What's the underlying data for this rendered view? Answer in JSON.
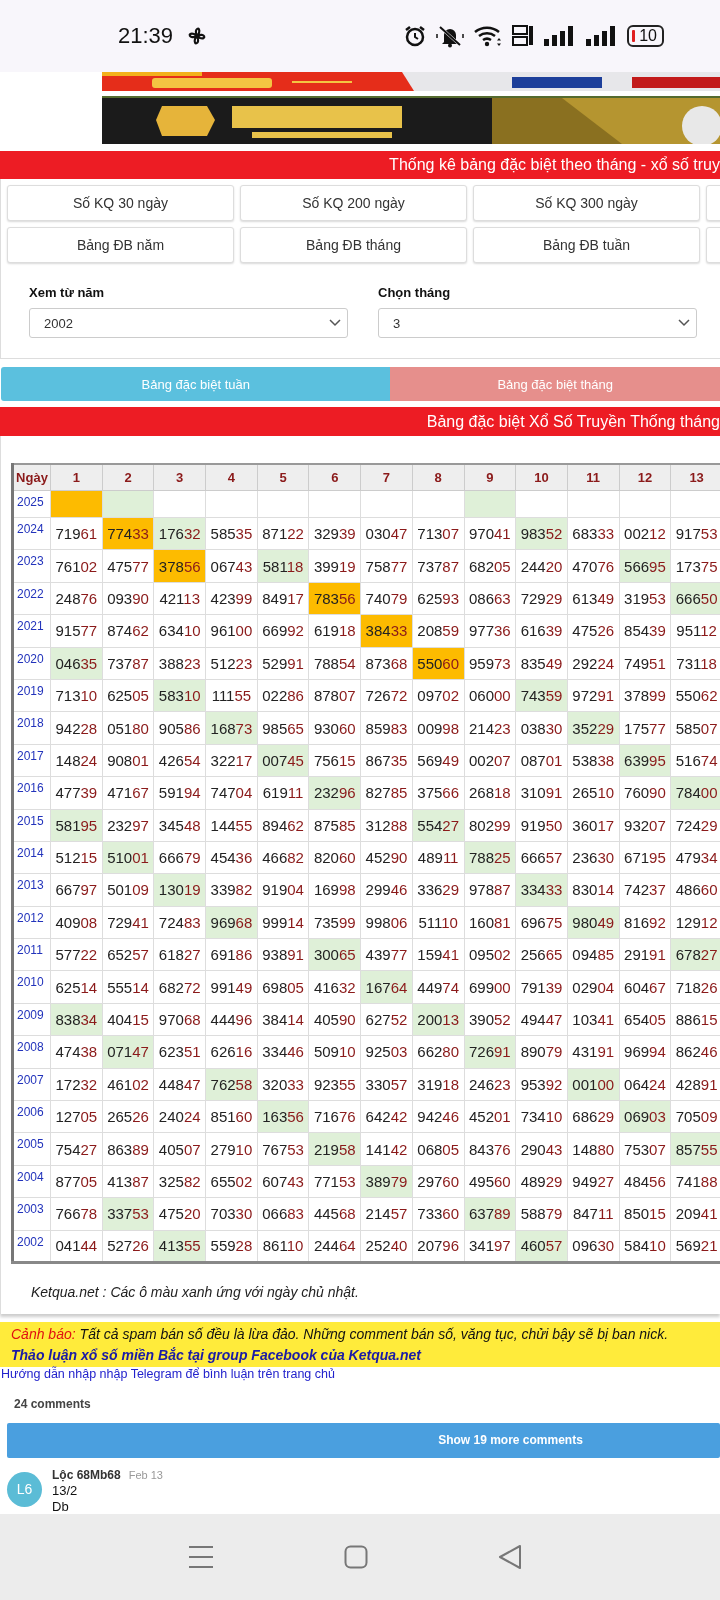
{
  "status_bar": {
    "time": "21:39",
    "battery": "10"
  },
  "stats_header": {
    "title": "Thống kê bảng đặc biệt theo tháng - xổ số truy"
  },
  "nav_buttons": [
    "Số KQ 30 ngày",
    "Số KQ 200 ngày",
    "Số KQ 300 ngày",
    "Bảng ĐB năm",
    "Bảng ĐB tháng",
    "Bảng ĐB tuần"
  ],
  "filters": [
    {
      "label": "Xem từ năm",
      "value": "2002"
    },
    {
      "label": "Chọn tháng",
      "value": "3"
    }
  ],
  "tabs": [
    {
      "label": "Bảng đặc biệt tuần",
      "color": "#5bc0de"
    },
    {
      "label": "Bảng đặc biệt tháng",
      "color": "#e68f8c"
    }
  ],
  "table": {
    "title": "Bảng đặc biệt Xổ Số Truyền Thống tháng",
    "corner_header": "Ngày",
    "columns": [
      "1",
      "2",
      "3",
      "4",
      "5",
      "6",
      "7",
      "8",
      "9",
      "10",
      "11",
      "12",
      "13"
    ],
    "rows": [
      {
        "year": "2025",
        "cells": [
          {
            "kind": "top"
          },
          {
            "kind": "sunday"
          },
          {
            "kind": "plain"
          },
          {
            "kind": "plain"
          },
          {
            "kind": "plain"
          },
          {
            "kind": "plain"
          },
          {
            "kind": "plain"
          },
          {
            "kind": "plain"
          },
          {
            "kind": "sunday"
          },
          {
            "kind": "plain"
          },
          {
            "kind": "plain"
          },
          {
            "kind": "plain"
          },
          {
            "kind": "plain"
          }
        ]
      },
      {
        "year": "2024",
        "cells": [
          {
            "value": "71961",
            "kind": "plain"
          },
          {
            "value": "77433",
            "kind": "top"
          },
          {
            "value": "17632",
            "kind": "sunday"
          },
          {
            "value": "58535",
            "kind": "plain"
          },
          {
            "value": "87122",
            "kind": "plain"
          },
          {
            "value": "32939",
            "kind": "plain"
          },
          {
            "value": "03047",
            "kind": "plain"
          },
          {
            "value": "71307",
            "kind": "plain"
          },
          {
            "value": "97041",
            "kind": "plain"
          },
          {
            "value": "98352",
            "kind": "sunday"
          },
          {
            "value": "68333",
            "kind": "plain"
          },
          {
            "value": "00212",
            "kind": "plain"
          },
          {
            "value": "91753",
            "kind": "plain"
          }
        ]
      },
      {
        "year": "2023",
        "cells": [
          {
            "value": "76102",
            "kind": "plain"
          },
          {
            "value": "47577",
            "kind": "plain"
          },
          {
            "value": "37856",
            "kind": "top"
          },
          {
            "value": "06743",
            "kind": "plain"
          },
          {
            "value": "58118",
            "kind": "sunday"
          },
          {
            "value": "39919",
            "kind": "plain"
          },
          {
            "value": "75877",
            "kind": "plain"
          },
          {
            "value": "73787",
            "kind": "plain"
          },
          {
            "value": "68205",
            "kind": "plain"
          },
          {
            "value": "24420",
            "kind": "plain"
          },
          {
            "value": "47076",
            "kind": "plain"
          },
          {
            "value": "56695",
            "kind": "sunday"
          },
          {
            "value": "17375",
            "kind": "plain"
          }
        ]
      },
      {
        "year": "2022",
        "cells": [
          {
            "value": "24876",
            "kind": "plain"
          },
          {
            "value": "09390",
            "kind": "plain"
          },
          {
            "value": "42113",
            "kind": "plain"
          },
          {
            "value": "42399",
            "kind": "plain"
          },
          {
            "value": "84917",
            "kind": "plain"
          },
          {
            "value": "78356",
            "kind": "top"
          },
          {
            "value": "74079",
            "kind": "plain"
          },
          {
            "value": "62593",
            "kind": "plain"
          },
          {
            "value": "08663",
            "kind": "plain"
          },
          {
            "value": "72929",
            "kind": "plain"
          },
          {
            "value": "61349",
            "kind": "plain"
          },
          {
            "value": "31953",
            "kind": "plain"
          },
          {
            "value": "66650",
            "kind": "sunday"
          }
        ]
      },
      {
        "year": "2021",
        "cells": [
          {
            "value": "91577",
            "kind": "plain"
          },
          {
            "value": "87462",
            "kind": "plain"
          },
          {
            "value": "63410",
            "kind": "plain"
          },
          {
            "value": "96100",
            "kind": "plain"
          },
          {
            "value": "66992",
            "kind": "plain"
          },
          {
            "value": "61918",
            "kind": "plain"
          },
          {
            "value": "38433",
            "kind": "top"
          },
          {
            "value": "20859",
            "kind": "plain"
          },
          {
            "value": "97736",
            "kind": "plain"
          },
          {
            "value": "61639",
            "kind": "plain"
          },
          {
            "value": "47526",
            "kind": "plain"
          },
          {
            "value": "85439",
            "kind": "plain"
          },
          {
            "value": "95112",
            "kind": "plain"
          }
        ]
      },
      {
        "year": "2020",
        "cells": [
          {
            "value": "04635",
            "kind": "sunday"
          },
          {
            "value": "73787",
            "kind": "plain"
          },
          {
            "value": "38823",
            "kind": "plain"
          },
          {
            "value": "51223",
            "kind": "plain"
          },
          {
            "value": "52991",
            "kind": "plain"
          },
          {
            "value": "78854",
            "kind": "plain"
          },
          {
            "value": "87368",
            "kind": "plain"
          },
          {
            "value": "55060",
            "kind": "top"
          },
          {
            "value": "95973",
            "kind": "plain"
          },
          {
            "value": "83549",
            "kind": "plain"
          },
          {
            "value": "29224",
            "kind": "plain"
          },
          {
            "value": "74951",
            "kind": "plain"
          },
          {
            "value": "73118",
            "kind": "plain"
          }
        ]
      },
      {
        "year": "2019",
        "cells": [
          {
            "value": "71310",
            "kind": "plain"
          },
          {
            "value": "62505",
            "kind": "plain"
          },
          {
            "value": "58310",
            "kind": "sunday"
          },
          {
            "value": "11155",
            "kind": "plain"
          },
          {
            "value": "02286",
            "kind": "plain"
          },
          {
            "value": "87807",
            "kind": "plain"
          },
          {
            "value": "72672",
            "kind": "plain"
          },
          {
            "value": "09702",
            "kind": "plain"
          },
          {
            "value": "06000",
            "kind": "plain"
          },
          {
            "value": "74359",
            "kind": "sunday"
          },
          {
            "value": "97291",
            "kind": "plain"
          },
          {
            "value": "37899",
            "kind": "plain"
          },
          {
            "value": "55062",
            "kind": "plain"
          }
        ]
      },
      {
        "year": "2018",
        "cells": [
          {
            "value": "94228",
            "kind": "plain"
          },
          {
            "value": "05180",
            "kind": "plain"
          },
          {
            "value": "90586",
            "kind": "plain"
          },
          {
            "value": "16873",
            "kind": "sunday"
          },
          {
            "value": "98565",
            "kind": "plain"
          },
          {
            "value": "93060",
            "kind": "plain"
          },
          {
            "value": "85983",
            "kind": "plain"
          },
          {
            "value": "00998",
            "kind": "plain"
          },
          {
            "value": "21423",
            "kind": "plain"
          },
          {
            "value": "03830",
            "kind": "plain"
          },
          {
            "value": "35229",
            "kind": "sunday"
          },
          {
            "value": "17577",
            "kind": "plain"
          },
          {
            "value": "58507",
            "kind": "plain"
          }
        ]
      },
      {
        "year": "2017",
        "cells": [
          {
            "value": "14824",
            "kind": "plain"
          },
          {
            "value": "90801",
            "kind": "plain"
          },
          {
            "value": "42654",
            "kind": "plain"
          },
          {
            "value": "32217",
            "kind": "plain"
          },
          {
            "value": "00745",
            "kind": "sunday"
          },
          {
            "value": "75615",
            "kind": "plain"
          },
          {
            "value": "86735",
            "kind": "plain"
          },
          {
            "value": "56949",
            "kind": "plain"
          },
          {
            "value": "00207",
            "kind": "plain"
          },
          {
            "value": "08701",
            "kind": "plain"
          },
          {
            "value": "53838",
            "kind": "plain"
          },
          {
            "value": "63995",
            "kind": "sunday"
          },
          {
            "value": "51674",
            "kind": "plain"
          }
        ]
      },
      {
        "year": "2016",
        "cells": [
          {
            "value": "47739",
            "kind": "plain"
          },
          {
            "value": "47167",
            "kind": "plain"
          },
          {
            "value": "59194",
            "kind": "plain"
          },
          {
            "value": "74704",
            "kind": "plain"
          },
          {
            "value": "61911",
            "kind": "plain"
          },
          {
            "value": "23296",
            "kind": "sunday"
          },
          {
            "value": "82785",
            "kind": "plain"
          },
          {
            "value": "37566",
            "kind": "plain"
          },
          {
            "value": "26818",
            "kind": "plain"
          },
          {
            "value": "31091",
            "kind": "plain"
          },
          {
            "value": "26510",
            "kind": "plain"
          },
          {
            "value": "76090",
            "kind": "plain"
          },
          {
            "value": "78400",
            "kind": "sunday"
          }
        ]
      },
      {
        "year": "2015",
        "cells": [
          {
            "value": "58195",
            "kind": "sunday"
          },
          {
            "value": "23297",
            "kind": "plain"
          },
          {
            "value": "34548",
            "kind": "plain"
          },
          {
            "value": "14455",
            "kind": "plain"
          },
          {
            "value": "89462",
            "kind": "plain"
          },
          {
            "value": "87585",
            "kind": "plain"
          },
          {
            "value": "31288",
            "kind": "plain"
          },
          {
            "value": "55427",
            "kind": "sunday"
          },
          {
            "value": "80299",
            "kind": "plain"
          },
          {
            "value": "91950",
            "kind": "plain"
          },
          {
            "value": "36017",
            "kind": "plain"
          },
          {
            "value": "93207",
            "kind": "plain"
          },
          {
            "value": "72429",
            "kind": "plain"
          }
        ]
      },
      {
        "year": "2014",
        "cells": [
          {
            "value": "51215",
            "kind": "plain"
          },
          {
            "value": "51001",
            "kind": "sunday"
          },
          {
            "value": "66679",
            "kind": "plain"
          },
          {
            "value": "45436",
            "kind": "plain"
          },
          {
            "value": "46682",
            "kind": "plain"
          },
          {
            "value": "82060",
            "kind": "plain"
          },
          {
            "value": "45290",
            "kind": "plain"
          },
          {
            "value": "48911",
            "kind": "plain"
          },
          {
            "value": "78825",
            "kind": "sunday"
          },
          {
            "value": "66657",
            "kind": "plain"
          },
          {
            "value": "23630",
            "kind": "plain"
          },
          {
            "value": "67195",
            "kind": "plain"
          },
          {
            "value": "47934",
            "kind": "plain"
          }
        ]
      },
      {
        "year": "2013",
        "cells": [
          {
            "value": "66797",
            "kind": "plain"
          },
          {
            "value": "50109",
            "kind": "plain"
          },
          {
            "value": "13019",
            "kind": "sunday"
          },
          {
            "value": "33982",
            "kind": "plain"
          },
          {
            "value": "91904",
            "kind": "plain"
          },
          {
            "value": "16998",
            "kind": "plain"
          },
          {
            "value": "29946",
            "kind": "plain"
          },
          {
            "value": "33629",
            "kind": "plain"
          },
          {
            "value": "97887",
            "kind": "plain"
          },
          {
            "value": "33433",
            "kind": "sunday"
          },
          {
            "value": "83014",
            "kind": "plain"
          },
          {
            "value": "74237",
            "kind": "plain"
          },
          {
            "value": "48660",
            "kind": "plain"
          }
        ]
      },
      {
        "year": "2012",
        "cells": [
          {
            "value": "40908",
            "kind": "plain"
          },
          {
            "value": "72941",
            "kind": "plain"
          },
          {
            "value": "72483",
            "kind": "plain"
          },
          {
            "value": "96968",
            "kind": "sunday"
          },
          {
            "value": "99914",
            "kind": "plain"
          },
          {
            "value": "73599",
            "kind": "plain"
          },
          {
            "value": "99806",
            "kind": "plain"
          },
          {
            "value": "51110",
            "kind": "plain"
          },
          {
            "value": "16081",
            "kind": "plain"
          },
          {
            "value": "69675",
            "kind": "plain"
          },
          {
            "value": "98049",
            "kind": "sunday"
          },
          {
            "value": "81692",
            "kind": "plain"
          },
          {
            "value": "12912",
            "kind": "plain"
          }
        ]
      },
      {
        "year": "2011",
        "cells": [
          {
            "value": "57722",
            "kind": "plain"
          },
          {
            "value": "65257",
            "kind": "plain"
          },
          {
            "value": "61827",
            "kind": "plain"
          },
          {
            "value": "69186",
            "kind": "plain"
          },
          {
            "value": "93891",
            "kind": "plain"
          },
          {
            "value": "30065",
            "kind": "sunday"
          },
          {
            "value": "43977",
            "kind": "plain"
          },
          {
            "value": "15941",
            "kind": "plain"
          },
          {
            "value": "09502",
            "kind": "plain"
          },
          {
            "value": "25665",
            "kind": "plain"
          },
          {
            "value": "09485",
            "kind": "plain"
          },
          {
            "value": "29191",
            "kind": "plain"
          },
          {
            "value": "67827",
            "kind": "sunday"
          }
        ]
      },
      {
        "year": "2010",
        "cells": [
          {
            "value": "62514",
            "kind": "plain"
          },
          {
            "value": "55514",
            "kind": "plain"
          },
          {
            "value": "68272",
            "kind": "plain"
          },
          {
            "value": "99149",
            "kind": "plain"
          },
          {
            "value": "69805",
            "kind": "plain"
          },
          {
            "value": "41632",
            "kind": "plain"
          },
          {
            "value": "16764",
            "kind": "sunday"
          },
          {
            "value": "44974",
            "kind": "plain"
          },
          {
            "value": "69900",
            "kind": "plain"
          },
          {
            "value": "79139",
            "kind": "plain"
          },
          {
            "value": "02904",
            "kind": "plain"
          },
          {
            "value": "60467",
            "kind": "plain"
          },
          {
            "value": "71826",
            "kind": "plain"
          }
        ]
      },
      {
        "year": "2009",
        "cells": [
          {
            "value": "83834",
            "kind": "sunday"
          },
          {
            "value": "40415",
            "kind": "plain"
          },
          {
            "value": "97068",
            "kind": "plain"
          },
          {
            "value": "44496",
            "kind": "plain"
          },
          {
            "value": "38414",
            "kind": "plain"
          },
          {
            "value": "40590",
            "kind": "plain"
          },
          {
            "value": "62752",
            "kind": "plain"
          },
          {
            "value": "20013",
            "kind": "sunday"
          },
          {
            "value": "39052",
            "kind": "plain"
          },
          {
            "value": "49447",
            "kind": "plain"
          },
          {
            "value": "10341",
            "kind": "plain"
          },
          {
            "value": "65405",
            "kind": "plain"
          },
          {
            "value": "88615",
            "kind": "plain"
          }
        ]
      },
      {
        "year": "2008",
        "cells": [
          {
            "value": "47438",
            "kind": "plain"
          },
          {
            "value": "07147",
            "kind": "sunday"
          },
          {
            "value": "62351",
            "kind": "plain"
          },
          {
            "value": "62616",
            "kind": "plain"
          },
          {
            "value": "33446",
            "kind": "plain"
          },
          {
            "value": "50910",
            "kind": "plain"
          },
          {
            "value": "92503",
            "kind": "plain"
          },
          {
            "value": "66280",
            "kind": "plain"
          },
          {
            "value": "72691",
            "kind": "sunday"
          },
          {
            "value": "89079",
            "kind": "plain"
          },
          {
            "value": "43191",
            "kind": "plain"
          },
          {
            "value": "96994",
            "kind": "plain"
          },
          {
            "value": "86246",
            "kind": "plain"
          }
        ]
      },
      {
        "year": "2007",
        "cells": [
          {
            "value": "17232",
            "kind": "plain"
          },
          {
            "value": "46102",
            "kind": "plain"
          },
          {
            "value": "44847",
            "kind": "plain"
          },
          {
            "value": "76258",
            "kind": "sunday"
          },
          {
            "value": "32033",
            "kind": "plain"
          },
          {
            "value": "92355",
            "kind": "plain"
          },
          {
            "value": "33057",
            "kind": "plain"
          },
          {
            "value": "31918",
            "kind": "plain"
          },
          {
            "value": "24623",
            "kind": "plain"
          },
          {
            "value": "95392",
            "kind": "plain"
          },
          {
            "value": "00100",
            "kind": "sunday"
          },
          {
            "value": "06424",
            "kind": "plain"
          },
          {
            "value": "42891",
            "kind": "plain"
          }
        ]
      },
      {
        "year": "2006",
        "cells": [
          {
            "value": "12705",
            "kind": "plain"
          },
          {
            "value": "26526",
            "kind": "plain"
          },
          {
            "value": "24024",
            "kind": "plain"
          },
          {
            "value": "85160",
            "kind": "plain"
          },
          {
            "value": "16356",
            "kind": "sunday"
          },
          {
            "value": "71676",
            "kind": "plain"
          },
          {
            "value": "64242",
            "kind": "plain"
          },
          {
            "value": "94246",
            "kind": "plain"
          },
          {
            "value": "45201",
            "kind": "plain"
          },
          {
            "value": "73410",
            "kind": "plain"
          },
          {
            "value": "68629",
            "kind": "plain"
          },
          {
            "value": "06903",
            "kind": "sunday"
          },
          {
            "value": "70509",
            "kind": "plain"
          }
        ]
      },
      {
        "year": "2005",
        "cells": [
          {
            "value": "75427",
            "kind": "plain"
          },
          {
            "value": "86389",
            "kind": "plain"
          },
          {
            "value": "40507",
            "kind": "plain"
          },
          {
            "value": "27910",
            "kind": "plain"
          },
          {
            "value": "76753",
            "kind": "plain"
          },
          {
            "value": "21958",
            "kind": "sunday"
          },
          {
            "value": "14142",
            "kind": "plain"
          },
          {
            "value": "06805",
            "kind": "plain"
          },
          {
            "value": "84376",
            "kind": "plain"
          },
          {
            "value": "29043",
            "kind": "plain"
          },
          {
            "value": "14880",
            "kind": "plain"
          },
          {
            "value": "75307",
            "kind": "plain"
          },
          {
            "value": "85755",
            "kind": "sunday"
          }
        ]
      },
      {
        "year": "2004",
        "cells": [
          {
            "value": "87705",
            "kind": "plain"
          },
          {
            "value": "41387",
            "kind": "plain"
          },
          {
            "value": "32582",
            "kind": "plain"
          },
          {
            "value": "65502",
            "kind": "plain"
          },
          {
            "value": "60743",
            "kind": "plain"
          },
          {
            "value": "77153",
            "kind": "plain"
          },
          {
            "value": "38979",
            "kind": "sunday"
          },
          {
            "value": "29760",
            "kind": "plain"
          },
          {
            "value": "49560",
            "kind": "plain"
          },
          {
            "value": "48929",
            "kind": "plain"
          },
          {
            "value": "94927",
            "kind": "plain"
          },
          {
            "value": "48456",
            "kind": "plain"
          },
          {
            "value": "74188",
            "kind": "plain"
          }
        ]
      },
      {
        "year": "2003",
        "cells": [
          {
            "value": "76678",
            "kind": "plain"
          },
          {
            "value": "33753",
            "kind": "sunday"
          },
          {
            "value": "47520",
            "kind": "plain"
          },
          {
            "value": "70330",
            "kind": "plain"
          },
          {
            "value": "06683",
            "kind": "plain"
          },
          {
            "value": "44568",
            "kind": "plain"
          },
          {
            "value": "21457",
            "kind": "plain"
          },
          {
            "value": "73360",
            "kind": "plain"
          },
          {
            "value": "63789",
            "kind": "sunday"
          },
          {
            "value": "58879",
            "kind": "plain"
          },
          {
            "value": "84711",
            "kind": "plain"
          },
          {
            "value": "85015",
            "kind": "plain"
          },
          {
            "value": "20941",
            "kind": "plain"
          }
        ]
      },
      {
        "year": "2002",
        "cells": [
          {
            "value": "04144",
            "kind": "plain"
          },
          {
            "value": "52726",
            "kind": "plain"
          },
          {
            "value": "41355",
            "kind": "sunday"
          },
          {
            "value": "55928",
            "kind": "plain"
          },
          {
            "value": "86110",
            "kind": "plain"
          },
          {
            "value": "24464",
            "kind": "plain"
          },
          {
            "value": "25240",
            "kind": "plain"
          },
          {
            "value": "20796",
            "kind": "plain"
          },
          {
            "value": "34197",
            "kind": "plain"
          },
          {
            "value": "46057",
            "kind": "sunday"
          },
          {
            "value": "09630",
            "kind": "plain"
          },
          {
            "value": "58410",
            "kind": "plain"
          },
          {
            "value": "56921",
            "kind": "plain"
          }
        ]
      }
    ],
    "note": "Ketqua.net : Các ô màu xanh ứng với ngày chủ nhật."
  },
  "notice": {
    "warning_label": "Cảnh báo:",
    "warning_text": "Tất cả spam bán số đều là lừa đảo. Những comment bán số, văng tục, chửi bậy sẽ bị ban nick.",
    "facebook_link": "Thảo luận xổ số miền Bắc tại group Facebook của Ketqua.net",
    "telegram_link": "Hướng dẫn nhập nhập Telegram để bình luận trên trang chủ"
  },
  "comments": {
    "count": "24 comments",
    "more_button": "Show 19 more comments",
    "items": [
      {
        "initials": "L6",
        "author": "Lộc 68Mb68",
        "date": "Feb 13",
        "lines": [
          "13/2",
          "Db"
        ]
      }
    ]
  }
}
